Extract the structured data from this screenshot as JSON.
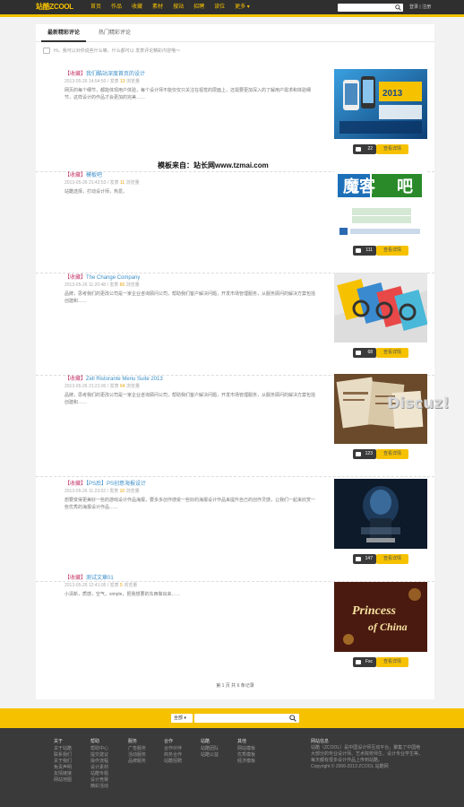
{
  "topbar": {
    "logo": "站酷ZCOOL",
    "nav": [
      "首页",
      "作品",
      "收藏",
      "素材",
      "搜站",
      "招聘",
      "读位",
      "更多 ▾"
    ],
    "search_placeholder": "",
    "login": "登录 | 注册"
  },
  "tabs": {
    "active": "最新精彩评论",
    "second": "热门精彩评论"
  },
  "notice": "Hi，我可以对你说些什么嘛，什么都可以 发表评论精彩内容哦～",
  "watermark": "模板来自：站长网www.tzmai.com",
  "discuz": "Discuz!",
  "posts": [
    {
      "tag": "【收藏】",
      "title": "我们酷站深度首页的设计",
      "date": "2013-05-26 14:54:50",
      "views_label": "发表",
      "views": "13",
      "views_suffix": "浏览量",
      "body": "网页的每个细节，都能体现用户体验，每个设计师不能仅仅只关注在视觉的层面上，还需要更加深入的了解用户需求和体验细节，这样设计的作品才会更加的完美……",
      "count": "22",
      "view": "查看详情"
    },
    {
      "tag": "【收藏】",
      "title": "模板吧",
      "date": "2013-05-26 21:42:53",
      "views_label": "发表",
      "views": "11",
      "views_suffix": "浏览量",
      "body": "站酷选择，打动设计师，热爱。",
      "count": "111",
      "view": "查看详情"
    },
    {
      "tag": "【收藏】",
      "title": "The Change Company",
      "date": "2013-05-26 11:20:48",
      "views_label": "发表",
      "views": "66",
      "views_suffix": "浏览量",
      "body": "品牌，思考我们的更改公司是一家企业咨询顾问公司，帮助我们客户解决问题，开发市场管理服务，从服务顾问的解决方案包括创建和……",
      "count": "68",
      "view": "查看详情"
    },
    {
      "tag": "【收藏】",
      "title": "Zell Ristorante Menu Suite 2013",
      "date": "2013-05-26 21:21:00",
      "views_label": "发表",
      "views": "64",
      "views_suffix": "浏览量",
      "body": "品牌，思考我们的更改公司是一家企业咨询顾问公司，帮助我们客户解决问题，开发市场管理服务，从服务顾问的解决方案包括创建和……",
      "count": "123",
      "view": "查看详情"
    },
    {
      "tag": "【收藏】",
      "title": "【PS后】PS创意海报设计",
      "date": "2013-05-26 11:23:02",
      "views_label": "发表",
      "views": "10",
      "views_suffix": "浏览量",
      "body": "想要变得更美好一些的游戏设计作品海报，要多多创作感受一些好的海报设计作品来提升自己的创作灵感，让我们一起来欣赏一些优秀的海报设计作品……",
      "count": "147",
      "view": "查看详情"
    },
    {
      "tag": "【收藏】",
      "title": "测试文章01",
      "date": "2013-05-26 12:41:05",
      "views_label": "发表",
      "views": "5",
      "views_suffix": "浏览量",
      "body": "小清新，质感，空气，simple，把我想要的东西做出来……",
      "count": "Fsc",
      "view": "查看详情"
    }
  ],
  "pager": "第 1 页 共 6 条记录",
  "footer_search": {
    "select": "全部 ▾"
  },
  "footer": {
    "cols": [
      {
        "h": "关于",
        "items": [
          "关于站酷",
          "联系我们",
          "关于我们",
          "免责声明",
          "友情链接",
          "网站地图"
        ]
      },
      {
        "h": "帮助",
        "items": [
          "帮助中心",
          "提交建议",
          "操作流程",
          "设计素材",
          "站酷专题",
          "设计竞赛",
          "精彩活动"
        ]
      },
      {
        "h": "服务",
        "items": [
          "广告服务",
          "活动服务",
          "品牌服务"
        ]
      },
      {
        "h": "合作",
        "items": [
          "合作伙伴",
          "商务合作",
          "站酷招聘"
        ]
      },
      {
        "h": "站酷",
        "items": [
          "站酷团队",
          "站酷公益"
        ]
      },
      {
        "h": "其他",
        "items": [
          "网站模板",
          "优秀模板",
          "经济模板"
        ]
      }
    ],
    "about_h": "网站信息",
    "about": "站酷（ZCOOL）是中国设计师互动平台，聚集了中国绝大部分的专业设计师、艺术院校师生、设计专业学生等，每天都有很多设计作品上传到站酷。",
    "copyright": "Copyright © 2006-2013 ZCOOL 站酷网"
  }
}
